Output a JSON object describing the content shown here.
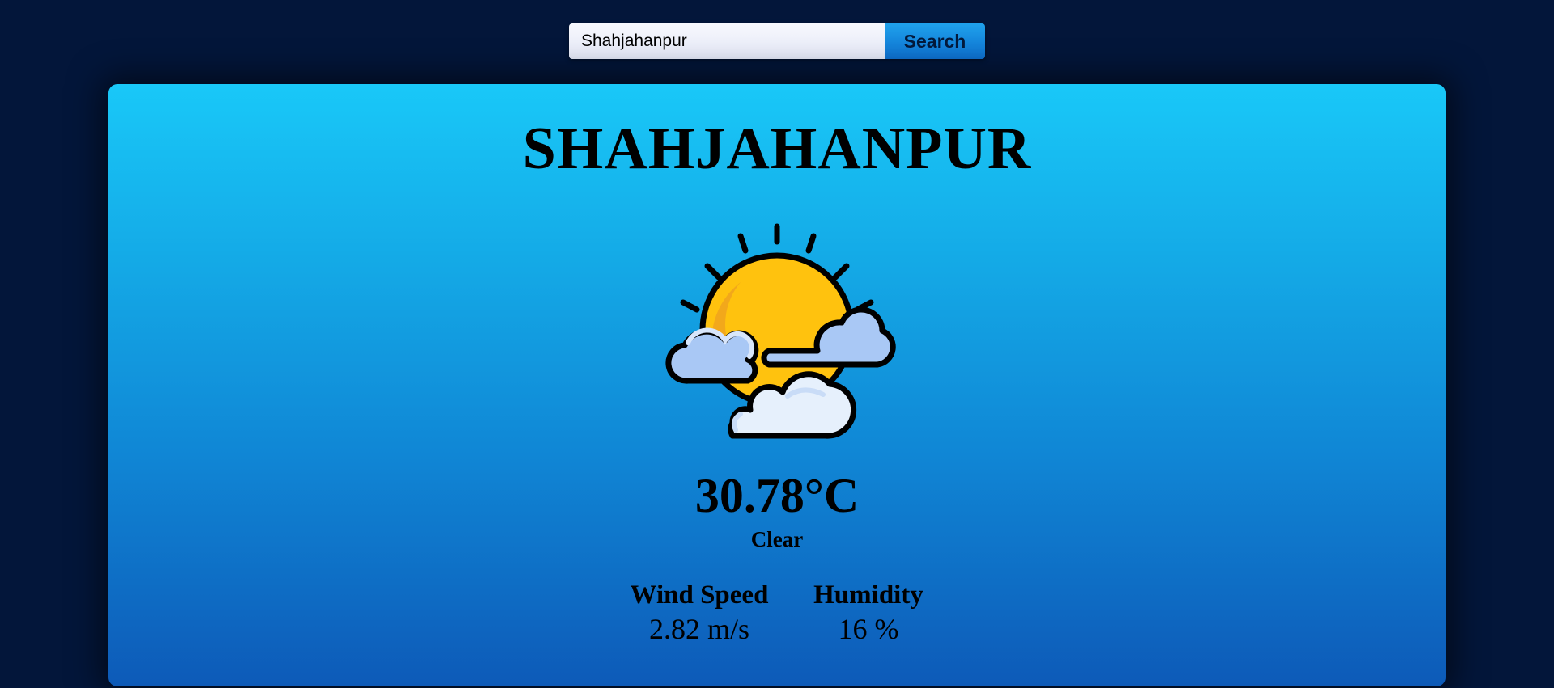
{
  "search": {
    "value": "Shahjahanpur",
    "button_label": "Search"
  },
  "weather": {
    "city": "SHAHJAHANPUR",
    "icon": "sun-behind-clouds-icon",
    "temperature": "30.78°C",
    "condition": "Clear"
  },
  "stats": {
    "wind": {
      "label": "Wind Speed",
      "value": "2.82 m/s"
    },
    "humidity": {
      "label": "Humidity",
      "value": "16 %"
    }
  },
  "colors": {
    "page_background": "#03163a",
    "card_gradient_top": "#19c8f8",
    "card_gradient_bottom": "#0d5ab8",
    "button_gradient_top": "#1fa2ec",
    "button_gradient_bottom": "#0d6fcf",
    "sun": "#ffc20e",
    "cloud": "#e6f0fc",
    "cloud_shade": "#a9c8f5"
  }
}
